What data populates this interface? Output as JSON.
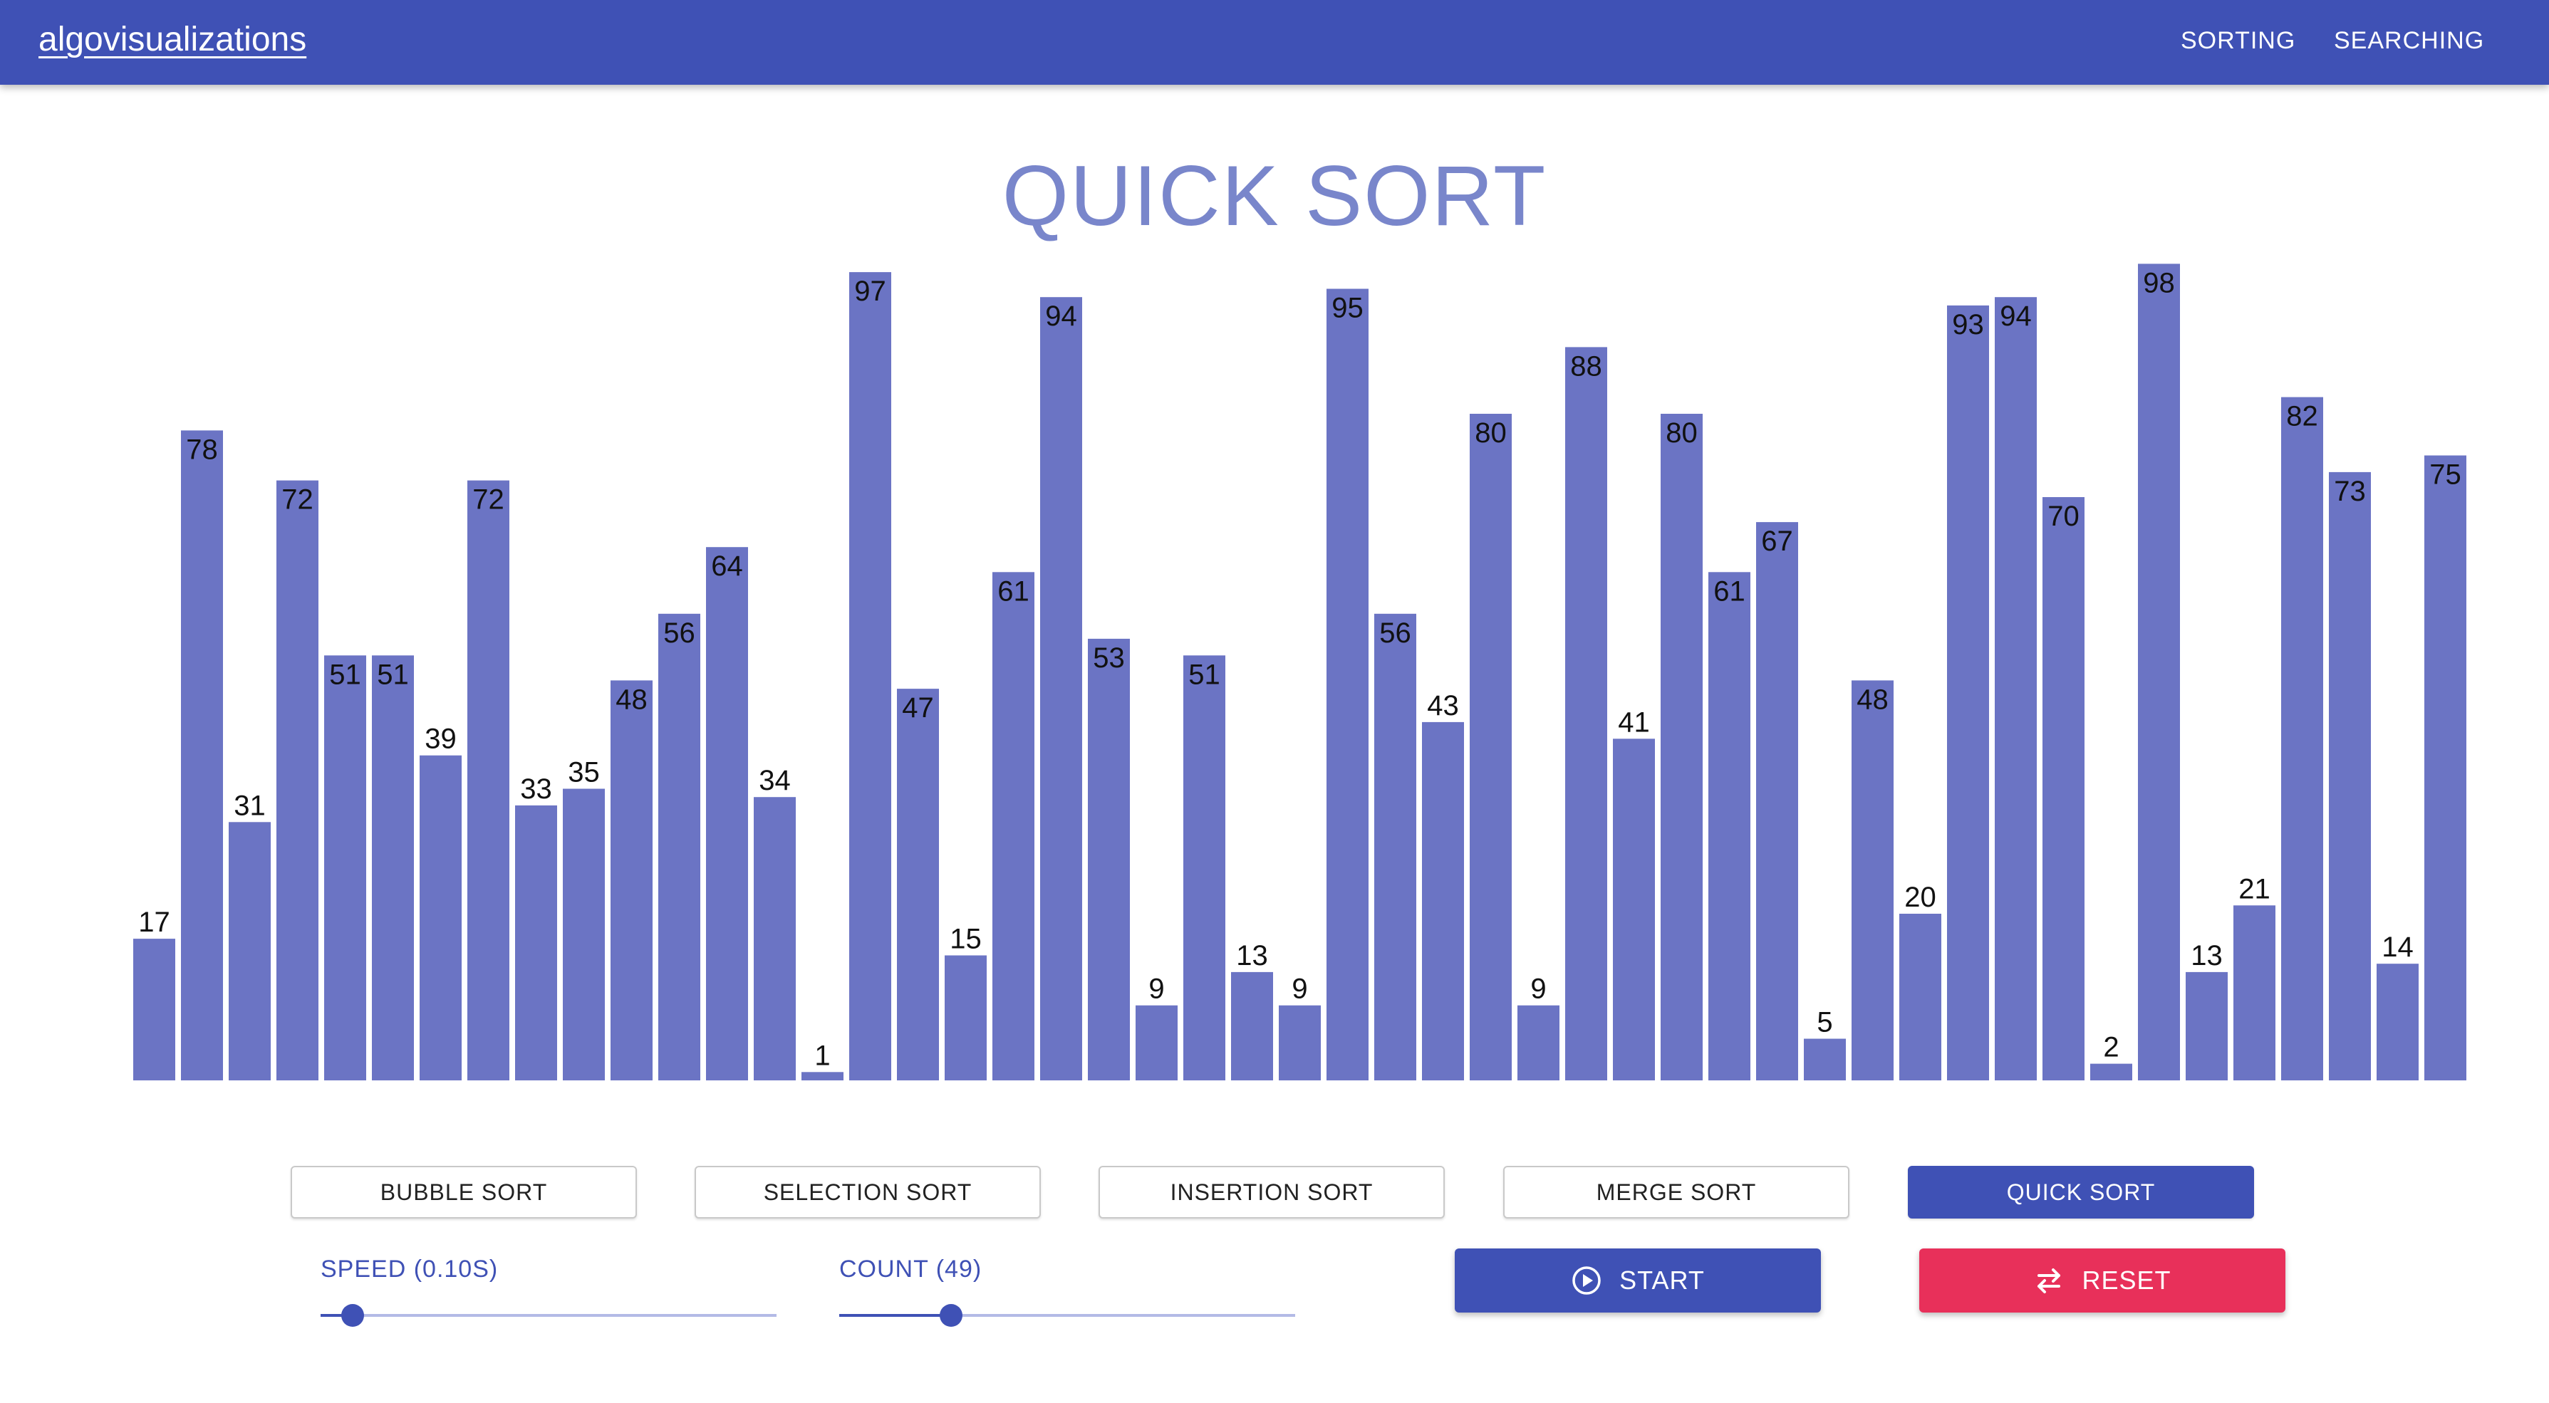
{
  "app": {
    "brand": "algovisualizations"
  },
  "nav": {
    "sorting": "SORTING",
    "searching": "SEARCHING"
  },
  "page": {
    "title": "QUICK SORT"
  },
  "chart_data": {
    "type": "bar",
    "values": [
      17,
      78,
      31,
      72,
      51,
      51,
      39,
      72,
      33,
      35,
      48,
      56,
      64,
      34,
      1,
      97,
      47,
      15,
      61,
      94,
      53,
      9,
      51,
      13,
      9,
      95,
      56,
      43,
      80,
      9,
      88,
      41,
      80,
      61,
      67,
      5,
      48,
      20,
      93,
      94,
      70,
      2,
      98,
      13,
      21,
      82,
      73,
      14,
      75
    ],
    "bar_color": "#6b74c4"
  },
  "algorithms": [
    {
      "label": "BUBBLE SORT",
      "active": false
    },
    {
      "label": "SELECTION SORT",
      "active": false
    },
    {
      "label": "INSERTION SORT",
      "active": false
    },
    {
      "label": "MERGE SORT",
      "active": false
    },
    {
      "label": "QUICK SORT",
      "active": true
    }
  ],
  "controls": {
    "speed": {
      "label": "SPEED (0.10S)",
      "fraction": 0.07
    },
    "count": {
      "label": "COUNT (49)",
      "fraction": 0.245
    },
    "start_label": "START",
    "reset_label": "RESET"
  },
  "icons": {
    "start": "play-circle-icon",
    "reset": "swap-arrows-icon"
  },
  "colors": {
    "primary": "#3f51b5",
    "accent": "#e8305a",
    "title": "#7986cb"
  }
}
